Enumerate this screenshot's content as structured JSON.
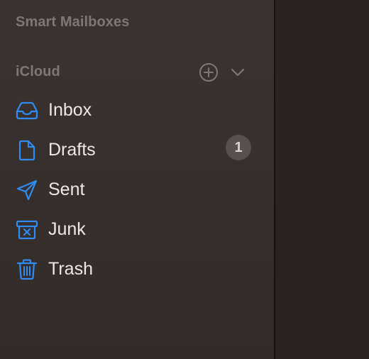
{
  "sidebar": {
    "smart_mailboxes_header": "Smart Mailboxes",
    "account_header": "iCloud",
    "header_icons": [
      "plus-circle-icon",
      "chevron-down-icon"
    ],
    "mailboxes": [
      {
        "label": "Inbox",
        "icon": "inbox-tray-icon"
      },
      {
        "label": "Drafts",
        "icon": "document-icon",
        "badge": "1"
      },
      {
        "label": "Sent",
        "icon": "paper-plane-icon"
      },
      {
        "label": "Junk",
        "icon": "junk-box-icon"
      },
      {
        "label": "Trash",
        "icon": "trash-icon"
      }
    ]
  },
  "colors": {
    "accent": "#2f8cf3",
    "sidebar_bg": "#37302d",
    "header_text": "#7f7774",
    "item_text": "#ece8e6",
    "badge_bg": "#57504d"
  }
}
